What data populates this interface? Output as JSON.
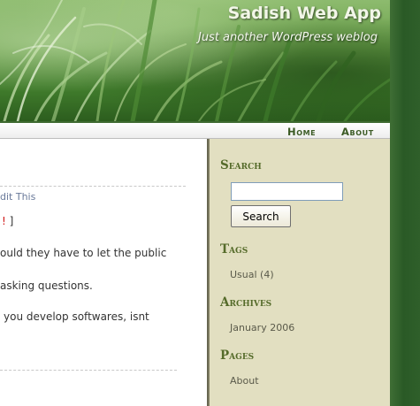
{
  "header": {
    "title": "Sadish Web App",
    "tagline": "Just another WordPress weblog"
  },
  "nav": {
    "items": [
      {
        "label": "Home"
      },
      {
        "label": "About"
      }
    ]
  },
  "post": {
    "edit_link": "dit This",
    "line1_bracket": "]",
    "line1_excl": "!",
    "line2": "ould they have to let the public",
    "line3": "asking questions.",
    "line4": "you develop softwares, isnt"
  },
  "sidebar": {
    "search": {
      "heading": "Search",
      "input_value": "",
      "button_label": "Search"
    },
    "tags": {
      "heading": "Tags",
      "items": [
        {
          "label": "Usual (4)"
        }
      ]
    },
    "archives": {
      "heading": "Archives",
      "items": [
        {
          "label": "January 2006"
        }
      ]
    },
    "pages": {
      "heading": "Pages",
      "items": [
        {
          "label": "About"
        }
      ]
    }
  },
  "colors": {
    "header_green": "#6aa04a",
    "nav_text": "#3b5a24",
    "sidebar_bg": "#e2dfc1",
    "sidebar_heading": "#556b2a",
    "outer_bg": "#2f5f2a",
    "exclamation": "#d01818"
  }
}
